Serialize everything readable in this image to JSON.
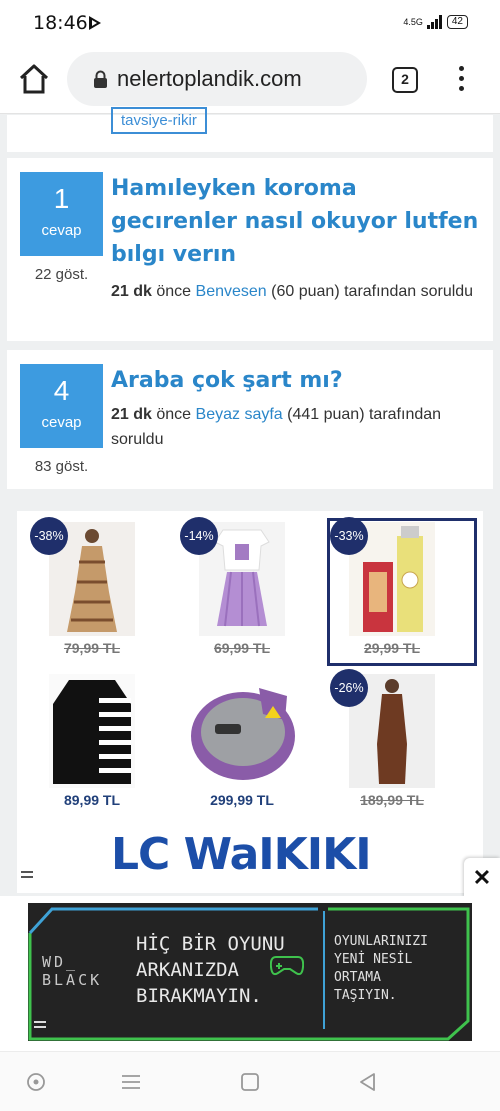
{
  "status_bar": {
    "time": "18:46",
    "network_label": "4.5G",
    "battery_level": "42"
  },
  "browser": {
    "url": "nelertoplandik.com",
    "tab_count": "2"
  },
  "partial_card": {
    "button_label": "tavsiye-rikir"
  },
  "questions": [
    {
      "answers": "1",
      "answers_label": "cevap",
      "views": "22 göst.",
      "title": "Hamıleyken koroma gecırenler nasıl okuyor lutfen bılgı verın",
      "time": "21 dk",
      "time_suffix": "önce",
      "user": "Benvesen",
      "points": "(60 puan) tarafından soruldu"
    },
    {
      "answers": "4",
      "answers_label": "cevap",
      "views": "83 göst.",
      "title": "Araba çok şart mı?",
      "time": "21 dk",
      "time_suffix": "önce",
      "user": "Beyaz sayfa",
      "points": "(441 puan) tarafından soruldu"
    }
  ],
  "ad": {
    "brand": "LC WaIKIKI",
    "products": [
      {
        "discount": "-38%",
        "price": "79,99 TL",
        "struck": true,
        "image": "patterned-dress"
      },
      {
        "discount": "-14%",
        "price": "69,99 TL",
        "struck": true,
        "image": "tshirt-skirt-outfit"
      },
      {
        "discount": "-33%",
        "price": "29,99 TL",
        "struck": true,
        "image": "cosmetic-bottles"
      },
      {
        "discount": "",
        "price": "89,99 TL",
        "struck": false,
        "image": "striped-sweater"
      },
      {
        "discount": "",
        "price": "299,99 TL",
        "struck": false,
        "image": "waffle-maker"
      },
      {
        "discount": "-26%",
        "price": "189,99 TL",
        "struck": true,
        "image": "brown-long-dress"
      }
    ]
  },
  "banner": {
    "brand_line1": "WD_",
    "brand_line2": "BLACK",
    "headline_line1": "HİÇ BİR OYUNU",
    "headline_line2": "ARKANIZDA",
    "headline_line3": "BIRAKMAYIN.",
    "sub_line1": "OYUNLARINIZI",
    "sub_line2": "YENİ NESİL",
    "sub_line3": "ORTAMA",
    "sub_line4": "TAŞIYIN.",
    "close_symbol": "✕",
    "accent_color": "#3fc24d"
  }
}
